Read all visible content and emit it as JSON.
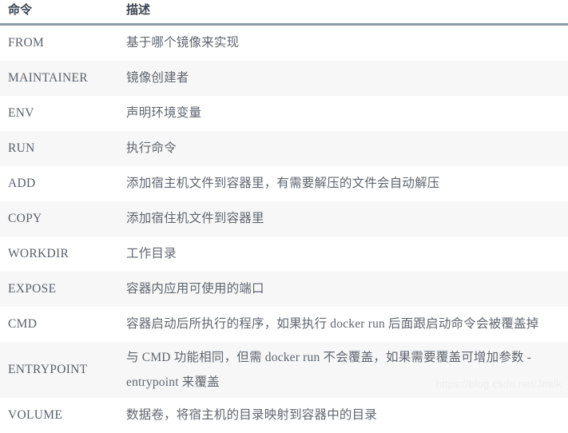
{
  "table": {
    "headers": {
      "command": "命令",
      "description": "描述"
    },
    "rows": [
      {
        "command": "FROM",
        "description": "基于哪个镜像来实现"
      },
      {
        "command": "MAINTAINER",
        "description": "镜像创建者"
      },
      {
        "command": "ENV",
        "description": "声明环境变量"
      },
      {
        "command": "RUN",
        "description": "执行命令"
      },
      {
        "command": "ADD",
        "description": "添加宿主机文件到容器里，有需要解压的文件会自动解压"
      },
      {
        "command": "COPY",
        "description": "添加宿住机文件到容器里"
      },
      {
        "command": "WORKDIR",
        "description": "工作目录"
      },
      {
        "command": "EXPOSE",
        "description": "容器内应用可使用的端口"
      },
      {
        "command": "CMD",
        "description": "容器启动后所执行的程序，如果执行 docker run 后面跟启动命令会被覆盖掉"
      },
      {
        "command": "ENTRYPOINT",
        "description": "与 CMD 功能相同，但需 docker run 不会覆盖，如果需要覆盖可增加参数 -entrypoint 来覆盖"
      },
      {
        "command": "VOLUME",
        "description": "数据卷，将宿主机的目录映射到容器中的目录"
      }
    ]
  },
  "watermark": {
    "text": "https://blog.csdn.net/Jmilk"
  },
  "colors": {
    "header_text": "#3b4450",
    "body_text": "#5f666f",
    "header_rule": "#8c9ba5",
    "stripe": "#f7f7f7",
    "background": "#ffffff",
    "watermark": "#eeeeee"
  }
}
